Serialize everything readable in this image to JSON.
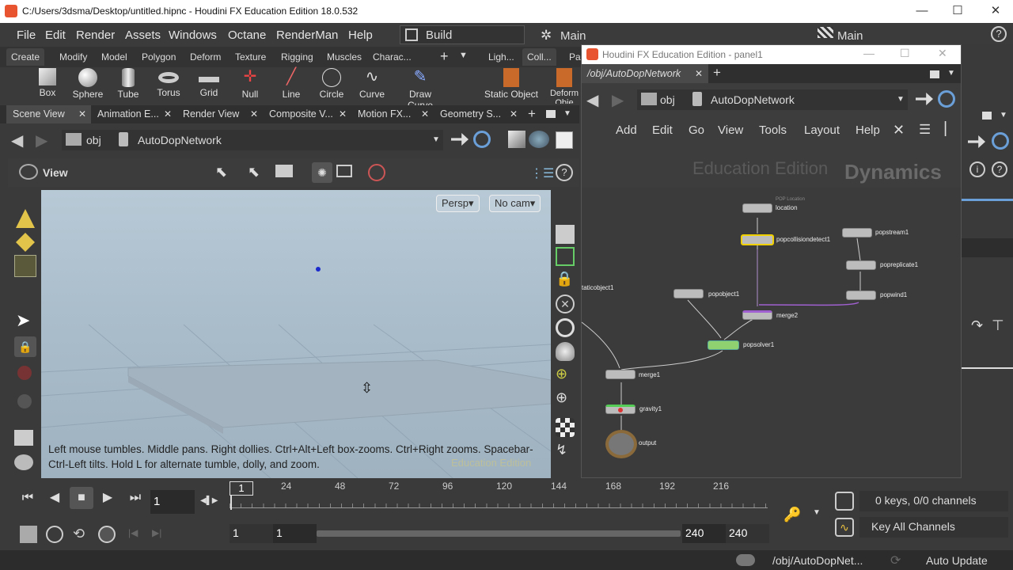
{
  "title_bar": {
    "title": "C:/Users/3dsma/Desktop/untitled.hipnc - Houdini FX Education Edition 18.0.532",
    "minimize": "—",
    "maximize": "☐",
    "close": "✕"
  },
  "menu": {
    "items": [
      "File",
      "Edit",
      "Render",
      "Assets",
      "Windows",
      "Octane",
      "RenderMan",
      "Help"
    ],
    "desktop": "Build",
    "main": "Main",
    "main2": "Main"
  },
  "shelf_tabs": [
    "Create",
    "Modify",
    "Model",
    "Polygon",
    "Deform",
    "Texture",
    "Rigging",
    "Muscles",
    "Charac..."
  ],
  "shelf_tabs_right": [
    "Ligh...",
    "Coll...",
    "Par"
  ],
  "shelf_tools": [
    "Box",
    "Sphere",
    "Tube",
    "Torus",
    "Grid",
    "Null",
    "Line",
    "Circle",
    "Curve",
    "Draw Curve"
  ],
  "shelf_right_tools": [
    "Static Object",
    "Deform Obje"
  ],
  "pane_tabs": [
    "Scene View",
    "Animation E...",
    "Render View",
    "Composite V...",
    "Motion FX...",
    "Geometry S..."
  ],
  "path": {
    "context": "obj",
    "node": "AutoDopNetwork"
  },
  "viewer": {
    "label": "View",
    "persp": "Persp",
    "cam": "No cam",
    "hint_line1": "Left mouse tumbles. Middle pans. Right dollies. Ctrl+Alt+Left box-zooms. Ctrl+Right zooms. Spacebar-",
    "hint_line2": "Ctrl-Left tilts. Hold L for alternate tumble, dolly, and zoom.",
    "watermark": "Education Edition"
  },
  "network": {
    "window_title": "Houdini FX Education Edition - panel1",
    "tab_path": "/obj/AutoDopNetwork",
    "context": "obj",
    "node": "AutoDopNetwork",
    "menu": [
      "Add",
      "Edit",
      "Go",
      "View",
      "Tools",
      "Layout",
      "Help"
    ],
    "watermark": "Education Edition",
    "dynamics": "Dynamics",
    "nodes": {
      "location": "location",
      "location_sub": "POP Location",
      "popcollisiondetect1": "popcollisiondetect1",
      "popstream1": "popstream1",
      "popreplicate1": "popreplicate1",
      "popwind1": "popwind1",
      "popobject1": "popobject1",
      "merge2": "merge2",
      "popsolver1": "popsolver1",
      "staticobject1": "taticobject1",
      "merge1": "merge1",
      "gravity1": "gravity1",
      "output": "output"
    }
  },
  "timeline": {
    "ticks": [
      "24",
      "48",
      "72",
      "96",
      "120",
      "144",
      "168",
      "192",
      "216"
    ],
    "current_frame": "1",
    "frame_marker": "1",
    "start": "1",
    "start2": "1",
    "end": "240",
    "end2": "240",
    "keys_info": "0 keys, 0/0 channels",
    "key_all": "Key All Channels"
  },
  "status": {
    "path": "/obj/AutoDopNet...",
    "update": "Auto Update"
  }
}
